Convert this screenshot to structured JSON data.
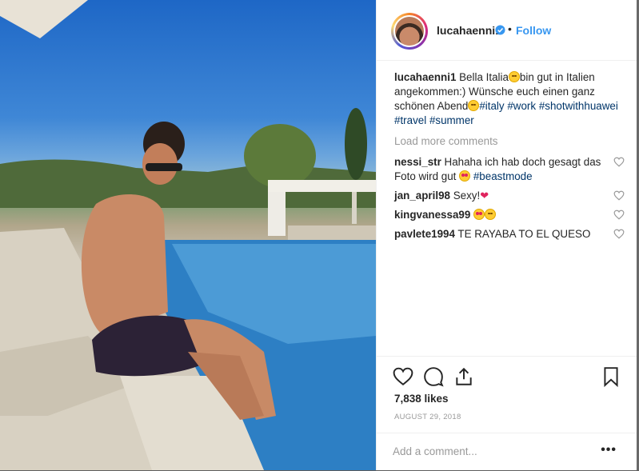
{
  "post": {
    "author": "lucahaenni1",
    "verified": true,
    "follow_label": "Follow",
    "separator": "•",
    "caption": {
      "username": "lucahaenni1",
      "text_1": " Bella Italia",
      "text_2": "bin gut in Italien angekommen:) Wünsche euch einen ganz schönen Abend",
      "hashtags": [
        "#italy",
        "#work",
        "#shotwithhuawei",
        "#travel",
        "#summer"
      ]
    },
    "load_more_label": "Load more comments",
    "comments": [
      {
        "username": "nessi_str",
        "text": " Hahaha ich hab doch gesagt das Foto wird gut ",
        "hashtag": "#beastmode",
        "emoji": "heart-eyes-emoji"
      },
      {
        "username": "jan_april98",
        "text": " Sexy!",
        "emoji": "red-heart-emoji"
      },
      {
        "username": "kingvanessa99",
        "text": " ",
        "emoji": "heart-eyes-emoji blush-emoji"
      },
      {
        "username": "pavlete1994",
        "text": " TE RAYABA TO EL QUESO",
        "emoji": ""
      }
    ],
    "likes": "7,838 likes",
    "date": "AUGUST 29, 2018",
    "add_comment_placeholder": "Add a comment...",
    "more_options": "•••"
  },
  "colors": {
    "follow": "#3897f0",
    "hashtag": "#003569",
    "muted": "#999999",
    "text": "#262626"
  },
  "icons": [
    "verified-badge-icon",
    "heart-icon",
    "comment-icon",
    "share-icon",
    "bookmark-icon",
    "comment-like-heart-icon"
  ]
}
